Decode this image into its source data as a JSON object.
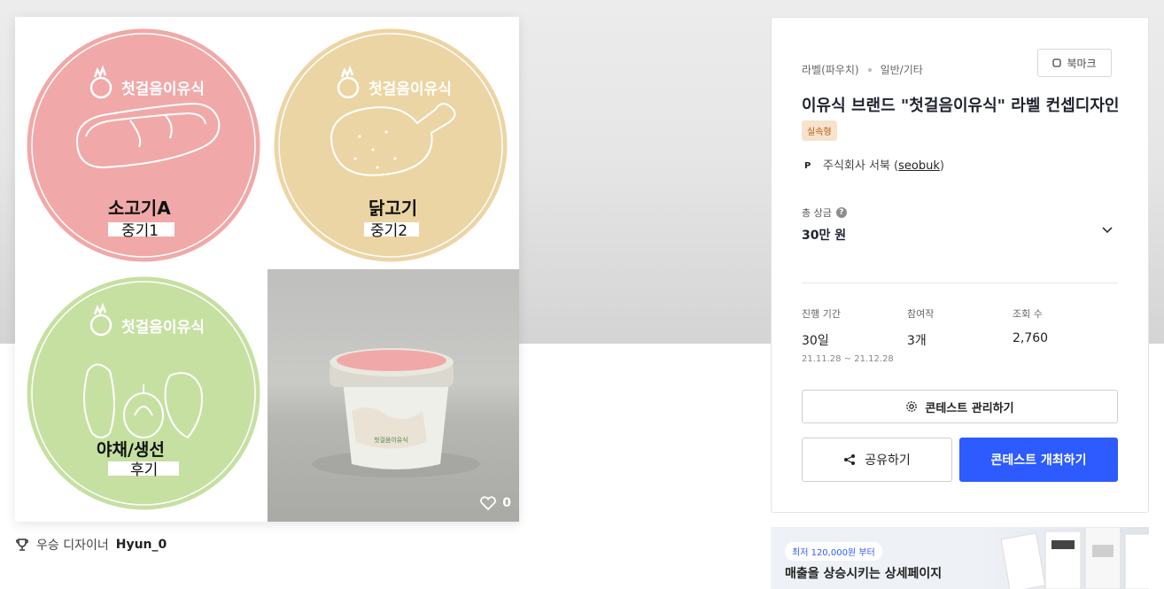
{
  "gallery": {
    "tiles": [
      {
        "brand": "첫걸음이유식",
        "name": "소고기A",
        "stage": "중기1",
        "color": "#f0a9a8"
      },
      {
        "brand": "첫걸음이유식",
        "name": "닭고기",
        "stage": "중기2",
        "color": "#ecd5a4"
      },
      {
        "brand": "첫걸음이유식",
        "name": "야채/생선",
        "stage": "후기",
        "color": "#c6e0a2"
      }
    ],
    "photo_label": "첫걸음이유식",
    "like_count": "0"
  },
  "winner": {
    "prefix": "우승 디자이너",
    "name": "Hyun_0"
  },
  "info": {
    "category": "라벨(파우치)",
    "subcategory": "일반/기타",
    "bookmark_label": "북마크",
    "title": "이유식 브랜드 \"첫걸음이유식\" 라벨 컨셉디자인",
    "badge": "실속형",
    "company_name": "주식회사 서북 (",
    "company_handle": "seobuk",
    "company_close": ")",
    "prize_label": "총 상금",
    "prize_value": "30만 원",
    "stats": [
      {
        "label": "진행 기간",
        "value": "30일",
        "sub": "21.11.28 ~ 21.12.28"
      },
      {
        "label": "참여작",
        "value": "3개"
      },
      {
        "label": "조회 수",
        "value": "2,760"
      }
    ],
    "manage_label": "콘테스트 관리하기",
    "share_label": "공유하기",
    "host_label": "콘테스트 개최하기"
  },
  "ad": {
    "chip": "최저 120,000원 부터",
    "title": "매출을 상승시키는 상세페이지"
  },
  "colors": {
    "accent": "#2d5bff",
    "badge_bg": "#f7e2cc",
    "badge_text": "#b65c12"
  }
}
